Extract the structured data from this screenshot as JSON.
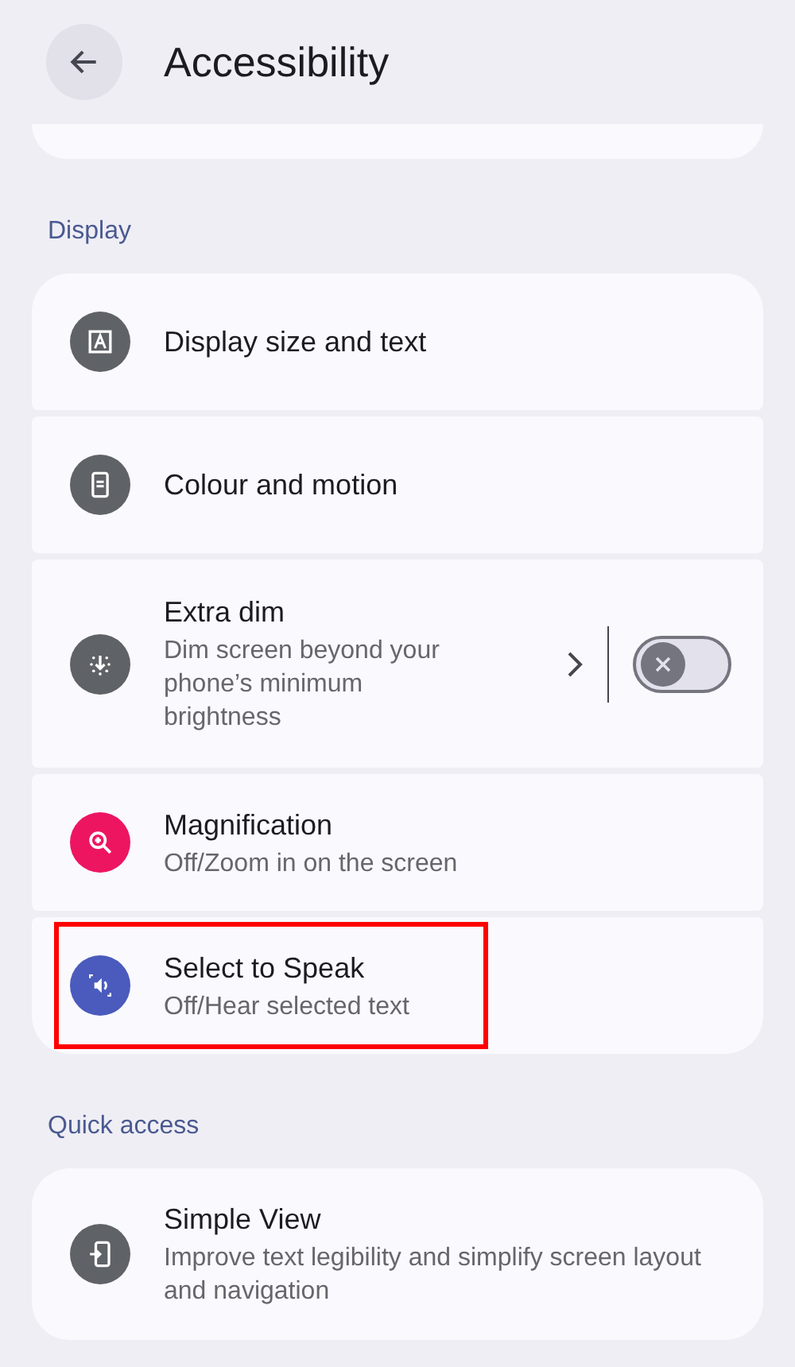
{
  "header": {
    "title": "Accessibility"
  },
  "sections": [
    {
      "label": "Display",
      "items": [
        {
          "kind": "nav",
          "color": "#5f6266",
          "title": "Display size and text",
          "highlighted": false
        },
        {
          "kind": "nav",
          "color": "#5f6266",
          "title": "Colour and motion",
          "highlighted": false
        },
        {
          "kind": "switch",
          "color": "#5f6266",
          "title": "Extra dim",
          "subtitle": "Dim screen beyond your phone’s minimum brightness",
          "on": false,
          "highlighted": false
        },
        {
          "kind": "nav",
          "color": "#ee1560",
          "title": "Magnification",
          "subtitle": "Off/Zoom in on the screen",
          "highlighted": false
        },
        {
          "kind": "nav",
          "color": "#4a5bbd",
          "title": "Select to Speak",
          "subtitle": "Off/Hear selected text",
          "highlighted": true
        }
      ]
    },
    {
      "label": "Quick access",
      "items": [
        {
          "kind": "nav",
          "color": "#5f6266",
          "title": "Simple View",
          "subtitle": "Improve text legibility and simplify screen layout and navigation",
          "highlighted": false
        }
      ]
    }
  ]
}
